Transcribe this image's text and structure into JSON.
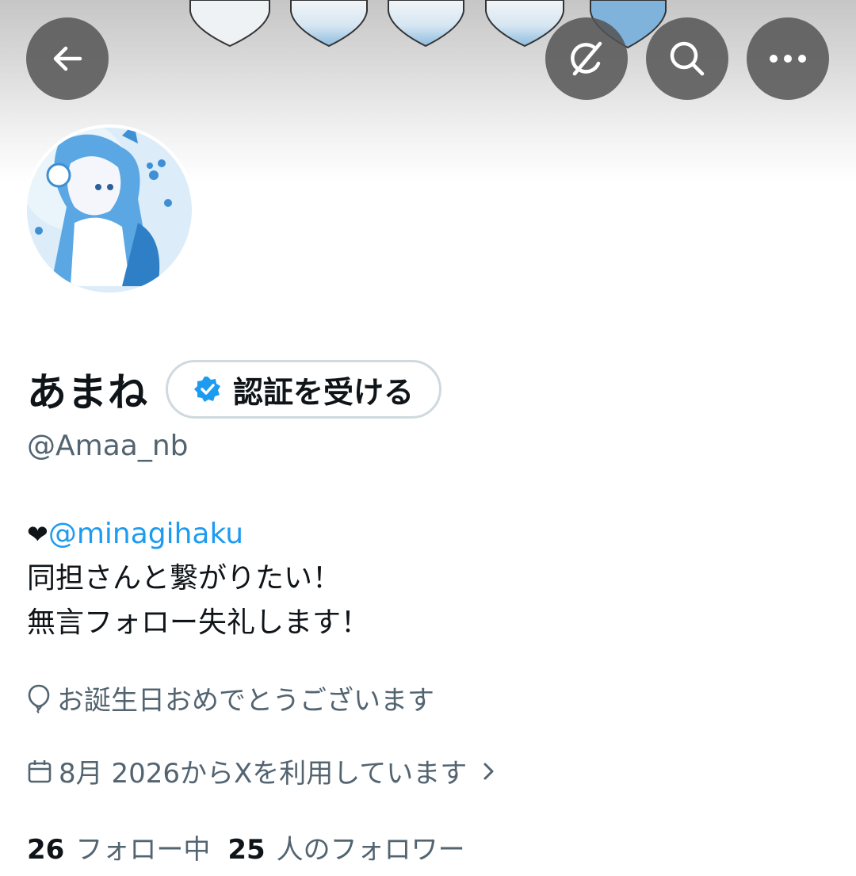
{
  "header": {
    "back_icon": "arrow-left-icon",
    "grok_icon": "grok-icon",
    "search_icon": "search-icon",
    "more_icon": "more-horizontal-icon"
  },
  "profile": {
    "display_name": "あまね",
    "verify_label": "認証を受ける",
    "handle": "@Amaa_nb",
    "bio_heart": "❤",
    "bio_mention": "@minagihaku",
    "bio_line2": "同担さんと繋がりたい！",
    "bio_line3": "無言フォロー失礼します！",
    "birthday_text": "お誕生日おめでとうございます",
    "joined_text": "8月 2026からXを利用しています",
    "following_count": "26",
    "following_label": "フォロー中",
    "followers_count": "25",
    "followers_label": "人のフォロワー"
  },
  "colors": {
    "accent": "#1d9bf0",
    "secondary_text": "#536471",
    "primary_text": "#0f1419",
    "button_bg": "#535353"
  }
}
